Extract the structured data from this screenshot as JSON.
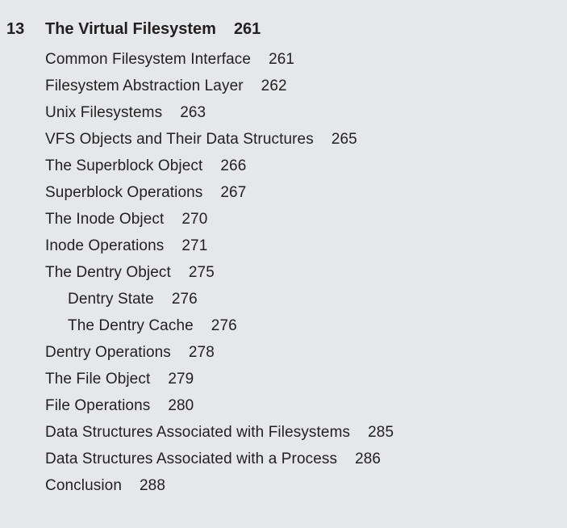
{
  "chapter": {
    "number": "13",
    "title": "The Virtual Filesystem",
    "page": "261"
  },
  "entries": [
    {
      "title": "Common Filesystem Interface",
      "page": "261",
      "level": 1
    },
    {
      "title": "Filesystem Abstraction Layer",
      "page": "262",
      "level": 1
    },
    {
      "title": "Unix Filesystems",
      "page": "263",
      "level": 1
    },
    {
      "title": "VFS Objects and Their Data Structures",
      "page": "265",
      "level": 1
    },
    {
      "title": "The Superblock Object",
      "page": "266",
      "level": 1
    },
    {
      "title": "Superblock Operations",
      "page": "267",
      "level": 1
    },
    {
      "title": "The Inode Object",
      "page": "270",
      "level": 1
    },
    {
      "title": "Inode Operations",
      "page": "271",
      "level": 1
    },
    {
      "title": "The Dentry Object",
      "page": "275",
      "level": 1
    },
    {
      "title": "Dentry State",
      "page": "276",
      "level": 2
    },
    {
      "title": "The Dentry Cache",
      "page": "276",
      "level": 2
    },
    {
      "title": "Dentry Operations",
      "page": "278",
      "level": 1
    },
    {
      "title": "The File Object",
      "page": "279",
      "level": 1
    },
    {
      "title": "File Operations",
      "page": "280",
      "level": 1
    },
    {
      "title": "Data Structures Associated with Filesystems",
      "page": "285",
      "level": 1
    },
    {
      "title": "Data Structures Associated with a Process",
      "page": "286",
      "level": 1
    },
    {
      "title": "Conclusion",
      "page": "288",
      "level": 1
    }
  ]
}
